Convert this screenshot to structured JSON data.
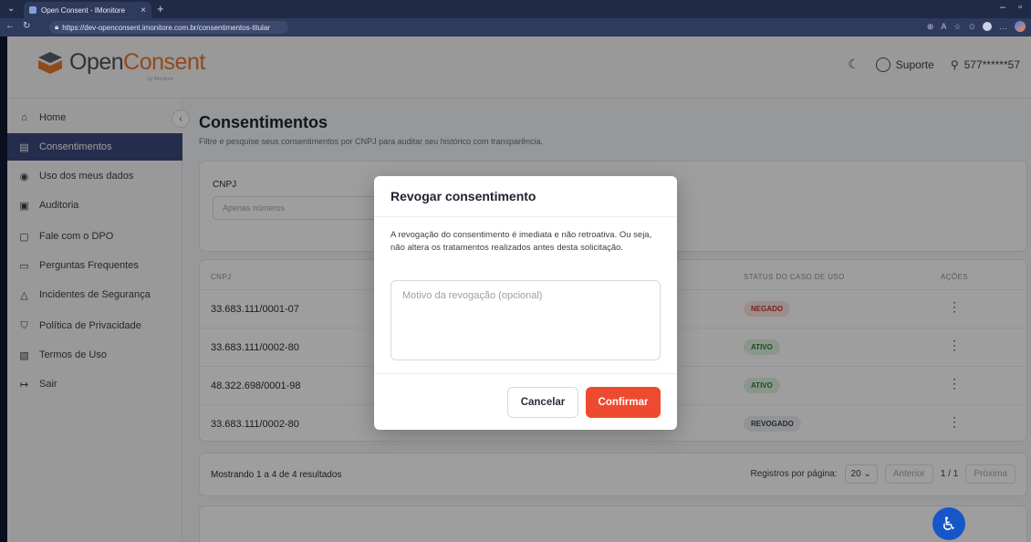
{
  "browser": {
    "tab_title": "Open Consent - IMonitore",
    "url": "https://dev-openconsent.imonitore.com.br/consentimentos-titular"
  },
  "header": {
    "logo_prefix": "Open",
    "logo_accent": "Consent",
    "logo_sub": "by IMonitore",
    "support_label": "Suporte",
    "user_label": "577******57"
  },
  "sidebar": {
    "items": [
      {
        "label": "Home",
        "icon": "home-icon"
      },
      {
        "label": "Consentimentos",
        "icon": "document-icon",
        "active": true
      },
      {
        "label": "Uso dos meus dados",
        "icon": "eye-icon"
      },
      {
        "label": "Auditoria",
        "icon": "clipboard-icon"
      },
      {
        "label": "Fale com o DPO",
        "icon": "file-icon"
      },
      {
        "label": "Perguntas Frequentes",
        "icon": "chat-icon"
      },
      {
        "label": "Incidentes de Segurança",
        "icon": "warning-icon"
      },
      {
        "label": "Política de Privacidade",
        "icon": "shield-icon"
      },
      {
        "label": "Termos de Uso",
        "icon": "terms-icon"
      },
      {
        "label": "Sair",
        "icon": "logout-icon"
      }
    ]
  },
  "main": {
    "title": "Consentimentos",
    "subtitle": "Filtre e pesquise seus consentimentos por CNPJ para auditar seu histórico com transparência.",
    "filter": {
      "cnpj_label": "CNPJ",
      "cnpj_placeholder": "Apenas números"
    },
    "table": {
      "headers": {
        "cnpj": "CNPJ",
        "status": "STATUS DO CASO DE USO",
        "actions": "AÇÕES"
      },
      "rows": [
        {
          "cnpj": "33.683.111/0001-07",
          "status": "NEGADO"
        },
        {
          "cnpj": "33.683.111/0002-80",
          "status": "ATIVO"
        },
        {
          "cnpj": "48.322.698/0001-98",
          "status": "ATIVO"
        },
        {
          "cnpj": "33.683.111/0002-80",
          "status": "REVOGADO"
        }
      ]
    },
    "footer": {
      "showing": "Mostrando 1 a 4 de 4 resultados",
      "per_page_label": "Registros por página:",
      "per_page_value": "20",
      "prev": "Anterior",
      "page": "1 / 1",
      "next": "Próxima"
    }
  },
  "modal": {
    "title": "Revogar consentimento",
    "text": "A revogação do consentimento é imediata e não retroativa. Ou seja, não altera os tratamentos realizados antes desta solicitação.",
    "textarea_placeholder": "Motivo da revogação (opcional)",
    "cancel": "Cancelar",
    "confirm": "Confirmar"
  },
  "colors": {
    "brand_accent": "#e8782c",
    "sidebar_active": "#3a4a7a",
    "confirm_button": "#ee4a2f",
    "status_negado_bg": "#fde2e2",
    "status_negado_fg": "#c0392b",
    "status_ativo_bg": "#dff3e2",
    "status_ativo_fg": "#2e7d32",
    "status_revogado_bg": "#eceef1",
    "status_revogado_fg": "#3b3f4a"
  }
}
